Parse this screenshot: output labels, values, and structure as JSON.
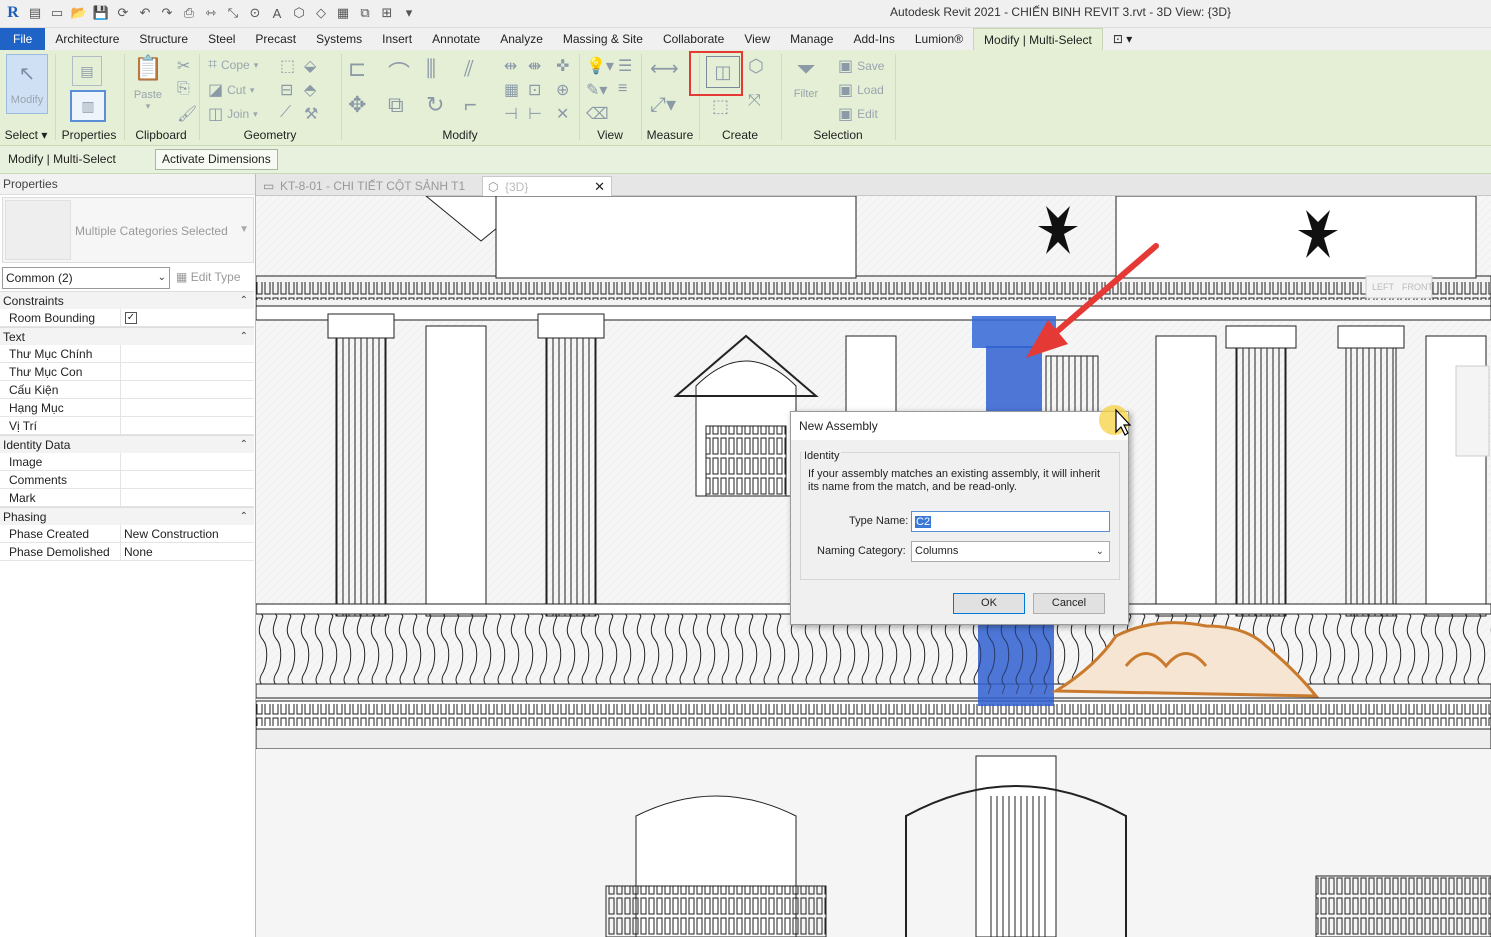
{
  "app": {
    "title": "Autodesk Revit 2021 - CHIẾN BINH REVIT 3.rvt - 3D View: {3D}",
    "logo_letter": "R"
  },
  "menu": {
    "file": "File",
    "tabs": [
      "Architecture",
      "Structure",
      "Steel",
      "Precast",
      "Systems",
      "Insert",
      "Annotate",
      "Analyze",
      "Massing & Site",
      "Collaborate",
      "View",
      "Manage",
      "Add-Ins",
      "Lumion®",
      "Modify | Multi-Select"
    ]
  },
  "ribbon": {
    "select": {
      "modify_label": "Modify",
      "panel": "Select ▾"
    },
    "properties": {
      "panel": "Properties"
    },
    "clipboard": {
      "paste": "Paste",
      "panel": "Clipboard"
    },
    "geometry": {
      "cope": "Cope",
      "cut": "Cut",
      "join": "Join",
      "panel": "Geometry"
    },
    "modify": {
      "panel": "Modify"
    },
    "view": {
      "panel": "View"
    },
    "measure": {
      "panel": "Measure"
    },
    "create": {
      "panel": "Create"
    },
    "filter": {
      "label": "Filter"
    },
    "selection": {
      "save": "Save",
      "load": "Load",
      "edit": "Edit",
      "panel": "Selection"
    }
  },
  "options_bar": {
    "context": "Modify | Multi-Select",
    "activate_dimensions": "Activate Dimensions"
  },
  "properties": {
    "title": "Properties",
    "type_label": "Multiple Categories Selected",
    "filter": "Common (2)",
    "edit_type": "Edit Type",
    "groups": [
      {
        "name": "Constraints",
        "rows": [
          {
            "k": "Room Bounding",
            "v": "",
            "checkbox": true
          }
        ]
      },
      {
        "name": "Text",
        "rows": [
          {
            "k": "Thư Mục Chính",
            "v": ""
          },
          {
            "k": "Thư Mục Con",
            "v": ""
          },
          {
            "k": "Cấu Kiện",
            "v": ""
          },
          {
            "k": "Hạng Mục",
            "v": ""
          },
          {
            "k": "Vị Trí",
            "v": ""
          }
        ]
      },
      {
        "name": "Identity Data",
        "rows": [
          {
            "k": "Image",
            "v": ""
          },
          {
            "k": "Comments",
            "v": ""
          },
          {
            "k": "Mark",
            "v": ""
          }
        ]
      },
      {
        "name": "Phasing",
        "rows": [
          {
            "k": "Phase Created",
            "v": "New Construction"
          },
          {
            "k": "Phase Demolished",
            "v": "None"
          }
        ]
      }
    ]
  },
  "view_tabs": [
    {
      "label": "KT-8-01 - CHI TIẾT CỘT SẢNH T1",
      "active": false
    },
    {
      "label": "{3D}",
      "active": true
    }
  ],
  "viewcube": {
    "left": "LEFT",
    "front": "FRONT"
  },
  "dialog": {
    "title": "New Assembly",
    "group": "Identity",
    "info": "If your assembly matches an existing assembly, it will inherit its name from the match, and be read-only.",
    "type_name_label": "Type Name:",
    "type_name_value": "C2",
    "naming_category_label": "Naming Category:",
    "naming_category_value": "Columns",
    "ok": "OK",
    "cancel": "Cancel"
  },
  "colors": {
    "accent": "#1f63c6",
    "ribbon_bg": "#e4efd6",
    "highlight_column": "#2f5fd0",
    "highlight_ornament": "#c97a2c",
    "callout_red": "#e53935"
  }
}
